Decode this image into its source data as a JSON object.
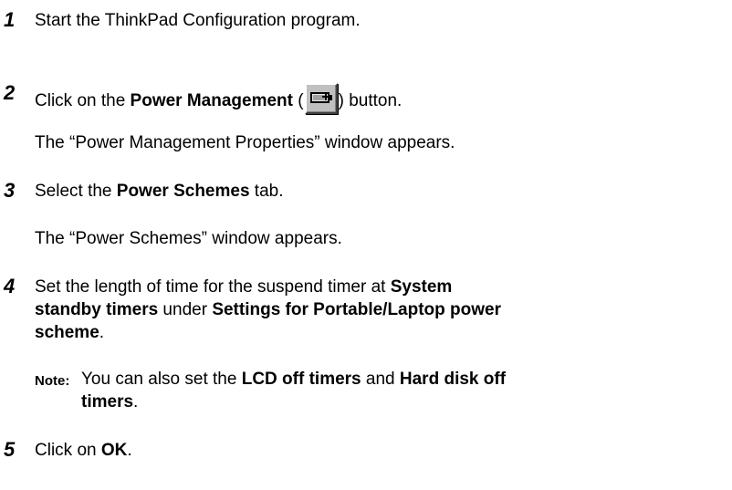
{
  "steps": [
    {
      "number": "1",
      "text": "Start the ThinkPad Configuration program."
    },
    {
      "number": "2",
      "pre": "Click on the ",
      "bold": "Power Management",
      "open": " (",
      "icon": "battery-icon",
      "close": ") button."
    },
    {
      "result2": "The “Power Management Properties” window appears."
    },
    {
      "number": "3",
      "pre": "Select the ",
      "bold": "Power Schemes",
      "post": " tab."
    },
    {
      "result3": "The “Power Schemes” window appears."
    },
    {
      "number": "4",
      "l1_pre": "Set the length of time for the suspend timer at ",
      "l1_bold": "System",
      "l2_bold": "standby timers",
      "l2_mid": " under ",
      "l2_bold2": "Settings for Portable/Laptop power",
      "l3_bold": "scheme",
      "l3_post": "."
    },
    {
      "note_label": "Note:",
      "n1_pre": "You can also set the ",
      "n1_bold": "LCD off timers",
      "n1_mid": " and ",
      "n1_bold2": "Hard disk off",
      "n2_bold": "timers",
      "n2_post": "."
    },
    {
      "number": "5",
      "pre": "Click on ",
      "bold": "OK",
      "post": "."
    }
  ]
}
